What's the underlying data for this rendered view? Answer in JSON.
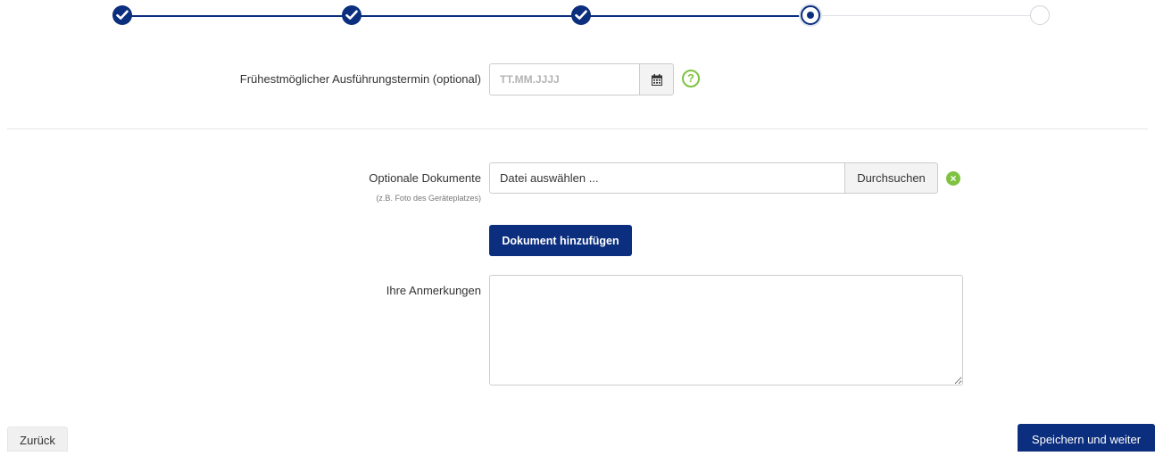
{
  "stepper": {
    "steps": [
      {
        "status": "done",
        "icon": "check-icon"
      },
      {
        "status": "done",
        "icon": "check-icon"
      },
      {
        "status": "done",
        "icon": "check-icon"
      },
      {
        "status": "current",
        "icon": "dot-icon"
      },
      {
        "status": "todo",
        "icon": ""
      }
    ],
    "active_color": "#0b2e7e",
    "inactive_color": "#cfd3da"
  },
  "form": {
    "date_label": "Frühestmöglicher Ausführungstermin (optional)",
    "date_placeholder": "TT.MM.JJJJ",
    "date_value": "",
    "calendar_icon": "calendar-icon",
    "help_icon": "question-circle-icon",
    "help_icon_glyph": "?",
    "documents_label": "Optionale Dokumente",
    "documents_hint": "(z.B. Foto des Geräteplatzes)",
    "file_placeholder": "Datei auswählen ...",
    "browse_label": "Durchsuchen",
    "remove_icon": "remove-circle-icon",
    "remove_icon_glyph": "×",
    "add_document_label": "Dokument hinzufügen",
    "remarks_label": "Ihre Anmerkungen",
    "remarks_value": ""
  },
  "footer": {
    "back_label": "Zurück",
    "save_label": "Speichern und weiter"
  },
  "colors": {
    "primary": "#0b2e7e",
    "accent_green": "#7fc241"
  }
}
